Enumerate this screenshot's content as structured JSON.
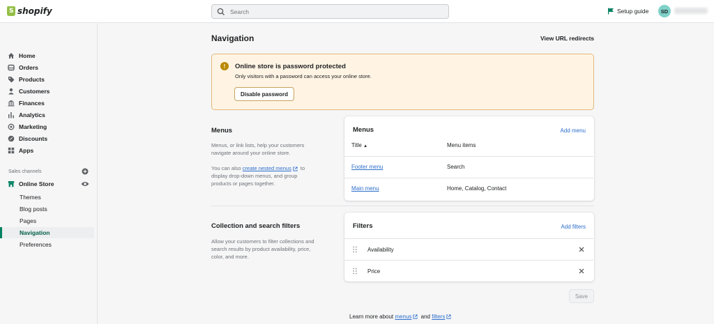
{
  "topbar": {
    "logo_text": "shopify",
    "search_placeholder": "Search",
    "setup_guide": "Setup guide",
    "avatar_initials": "SD"
  },
  "sidebar": {
    "items": [
      {
        "label": "Home",
        "icon": "home-icon"
      },
      {
        "label": "Orders",
        "icon": "orders-icon"
      },
      {
        "label": "Products",
        "icon": "tag-icon"
      },
      {
        "label": "Customers",
        "icon": "person-icon"
      },
      {
        "label": "Finances",
        "icon": "bank-icon"
      },
      {
        "label": "Analytics",
        "icon": "bar-chart-icon"
      },
      {
        "label": "Marketing",
        "icon": "target-icon"
      },
      {
        "label": "Discounts",
        "icon": "discount-icon"
      },
      {
        "label": "Apps",
        "icon": "apps-icon"
      }
    ],
    "sales_channels_label": "Sales channels",
    "online_store": "Online Store",
    "sub_items": [
      {
        "label": "Themes"
      },
      {
        "label": "Blog posts"
      },
      {
        "label": "Pages"
      },
      {
        "label": "Navigation",
        "active": true
      },
      {
        "label": "Preferences"
      }
    ]
  },
  "page": {
    "title": "Navigation",
    "view_redirects": "View URL redirects"
  },
  "banner": {
    "title": "Online store is password protected",
    "text": "Only visitors with a password can access your online store.",
    "button": "Disable password"
  },
  "menus_section": {
    "title": "Menus",
    "desc1_line1": "Menus, or link lists, help your customers",
    "desc1_line2": "navigate around your online store.",
    "desc2_prefix": "You can also",
    "desc2_link": "create nested menus",
    "desc2_suffix": "to",
    "desc2_line2": "display drop-down menus, and group",
    "desc2_line3": "products or pages together."
  },
  "menus_card": {
    "title": "Menus",
    "action": "Add menu",
    "col_title": "Title",
    "col_title_arrow": "▲",
    "col_items": "Menu items",
    "rows": [
      {
        "title": "Footer menu",
        "items": "Search"
      },
      {
        "title": "Main menu",
        "items": "Home, Catalog, Contact"
      }
    ]
  },
  "filters_section": {
    "title": "Collection and search filters",
    "line1": "Allow your customers to filter collections and",
    "line2": "search results by product availability, price,",
    "line3": "color, and more."
  },
  "filters_card": {
    "title": "Filters",
    "action": "Add filters",
    "rows": [
      {
        "label": "Availability"
      },
      {
        "label": "Price"
      }
    ]
  },
  "footer": {
    "save": "Save",
    "learn_prefix": "Learn more about",
    "learn_menus": "menus",
    "learn_and": "and",
    "learn_filters": "filters"
  },
  "colors": {
    "accent": "#008060",
    "link": "#2c6ecb",
    "banner_bg": "#fff4e4",
    "banner_border": "#e1b878"
  }
}
